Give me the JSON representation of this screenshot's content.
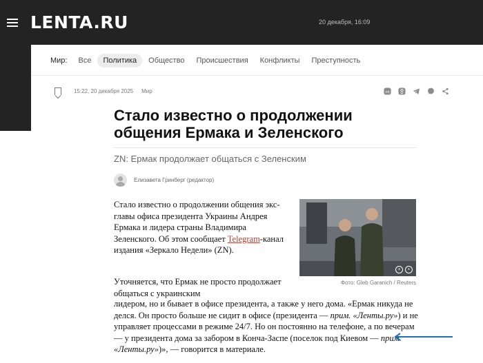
{
  "header": {
    "logo": "LENTA.RU",
    "datetime": "20 декабря, 16:09"
  },
  "nav": {
    "label": "Мир:",
    "tabs": [
      "Все",
      "Политика",
      "Общество",
      "Происшествия",
      "Конфликты",
      "Преступность"
    ],
    "active": "Политика"
  },
  "meta": {
    "time": "15:22, 20 декабря 2025",
    "rubric": "Мир"
  },
  "share_icons": [
    "vk-icon",
    "ok-icon",
    "telegram-icon",
    "chat-icon",
    "share-icon"
  ],
  "article": {
    "title": "Стало известно о продолжении общения Ермака и Зеленского",
    "subtitle": "ZN: Ермак продолжает общаться с Зеленским",
    "author": "Елизавета Гринберг (редактор)",
    "p1_before": "Стало известно о продолжении общения экс-главы офиса президента Украины Андрея Ермака и лидера страны Владимира Зеленского. Об этом сообщает ",
    "p1_link": "Telegram",
    "p1_after": "-канал издания «Зеркало Недели» (ZN).",
    "p2_start": "Уточняется, что Ермак не просто продолжает общаться с украинским",
    "p2_1": "лидером, но и бывает в офисе президента, а также у него дома. «Ермак никуда не делся. Он просто больше не сидит в офисе (президента — ",
    "p2_note1": "прим. «Ленты.ру»",
    "p2_2": ") и не управляет процессами в режиме 24/7. Но он постоянно на телефоне, а по вечерам — у президента дома за забором в Конча-Заспе (поселок под Киевом — ",
    "p2_note2": "прим. «Ленты.ру»",
    "p2_3": ")», — говорится в материале.",
    "photo_credit": "Фото: Gleb Garanich / Reuters"
  },
  "colors": {
    "topbar": "#232323",
    "link": "#c0392b",
    "arrow": "#1f6fb8"
  }
}
